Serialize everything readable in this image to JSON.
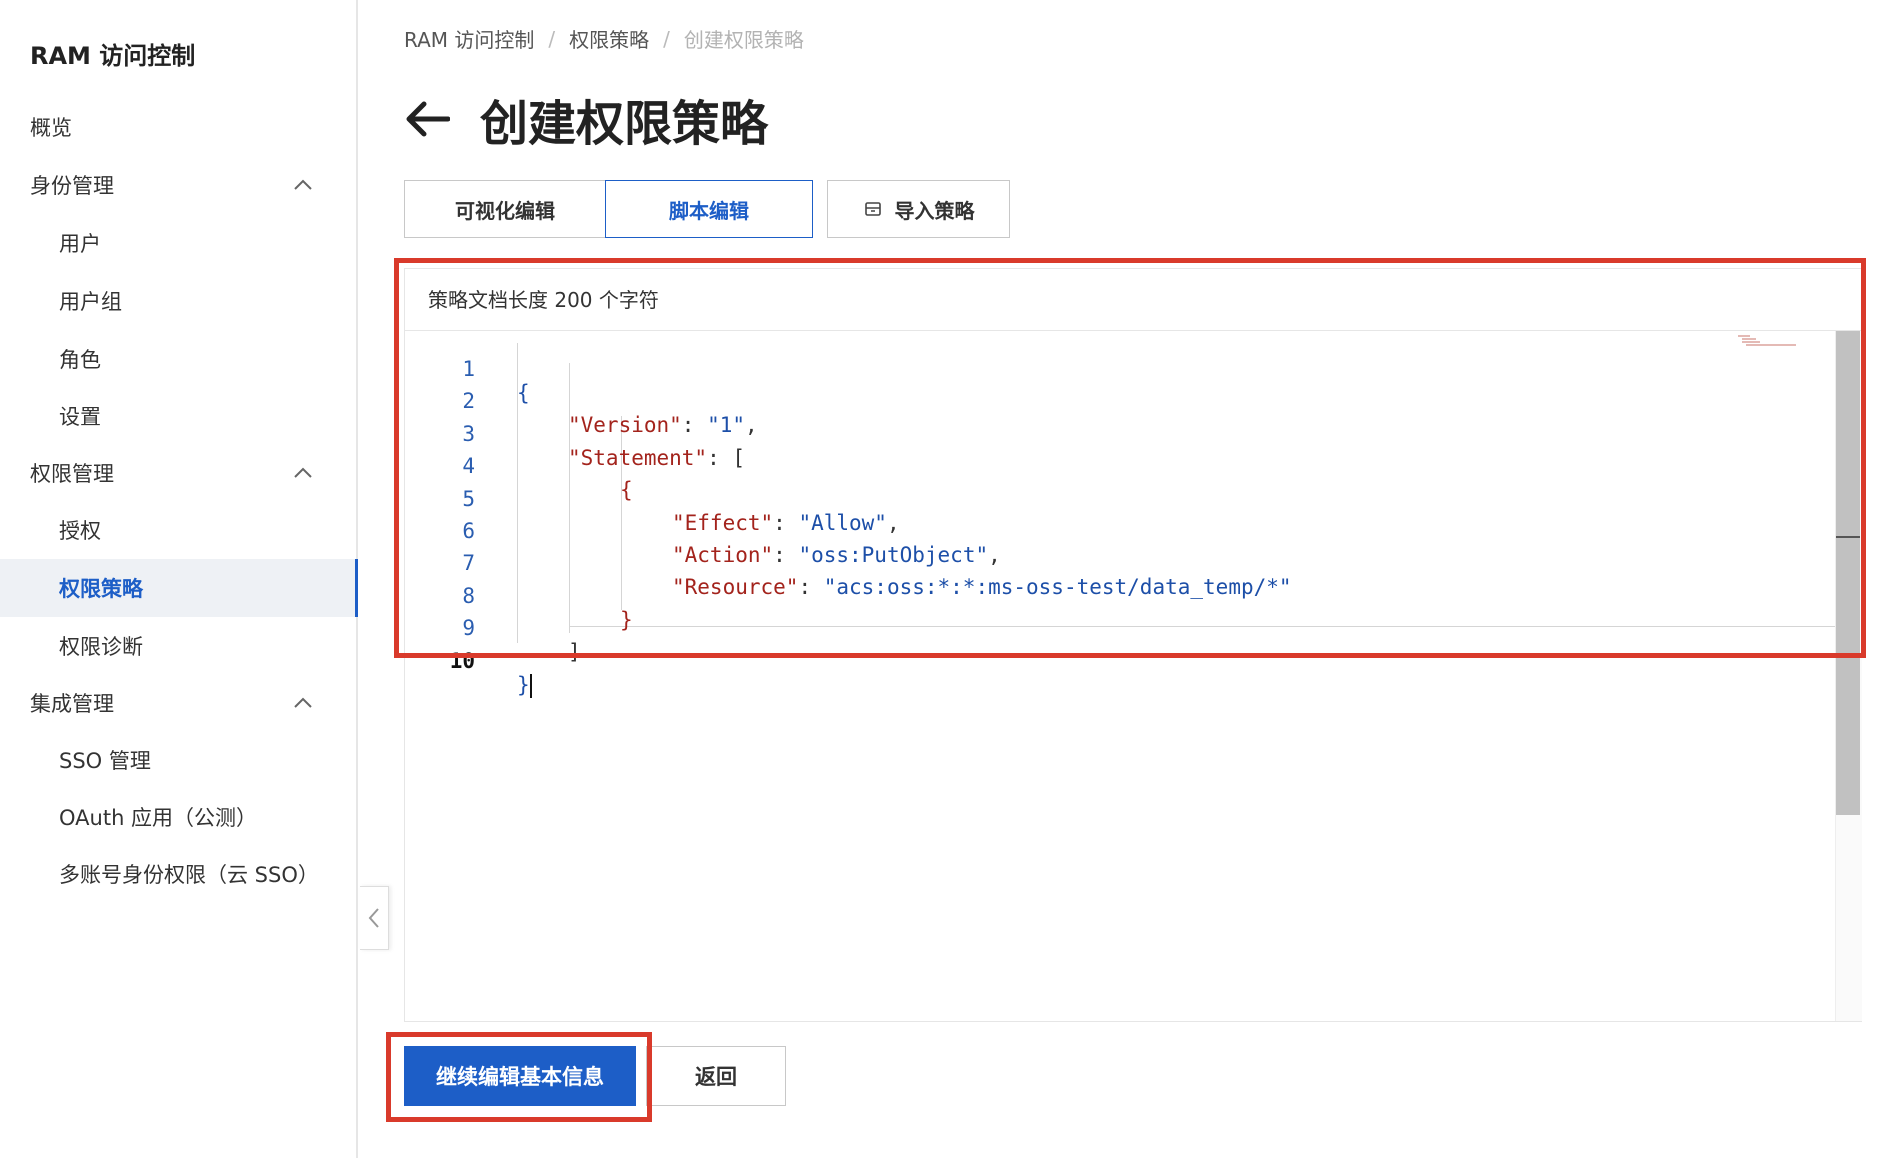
{
  "sidebar": {
    "title": "RAM 访问控制",
    "items": [
      {
        "label": "概览"
      },
      {
        "label": "身份管理"
      },
      {
        "label": "用户"
      },
      {
        "label": "用户组"
      },
      {
        "label": "角色"
      },
      {
        "label": "设置"
      },
      {
        "label": "权限管理"
      },
      {
        "label": "授权"
      },
      {
        "label": "权限策略",
        "active": true
      },
      {
        "label": "权限诊断"
      },
      {
        "label": "集成管理"
      },
      {
        "label": "SSO 管理"
      },
      {
        "label": "OAuth 应用（公测）"
      },
      {
        "label": "多账号身份权限（云 SSO）"
      }
    ]
  },
  "breadcrumb": {
    "items": [
      "RAM 访问控制",
      "权限策略",
      "创建权限策略"
    ],
    "separator": "/"
  },
  "page": {
    "title": "创建权限策略"
  },
  "tabs": {
    "visual": "可视化编辑",
    "script": "脚本编辑",
    "import": "导入策略",
    "active": "脚本编辑"
  },
  "editor": {
    "doc_length_text": "策略文档长度 200 个字符",
    "lines": [
      {
        "num": "1",
        "text": "{"
      },
      {
        "num": "2",
        "text": "\"Version\": \"1\","
      },
      {
        "num": "3",
        "text": "\"Statement\": ["
      },
      {
        "num": "4",
        "text": "{"
      },
      {
        "num": "5",
        "text": "\"Effect\": \"Allow\","
      },
      {
        "num": "6",
        "text": "\"Action\": \"oss:PutObject\","
      },
      {
        "num": "7",
        "text": "\"Resource\": \"acs:oss:*:*:ms-oss-test/data_temp/*\""
      },
      {
        "num": "8",
        "text": "}"
      },
      {
        "num": "9",
        "text": "]"
      },
      {
        "num": "10",
        "text": "}"
      }
    ],
    "tokens": {
      "l1_open": "{",
      "l2_key": "\"Version\"",
      "l2_colon": ": ",
      "l2_val": "\"1\"",
      "l2_comma": ",",
      "l3_key": "\"Statement\"",
      "l3_rest": ": [",
      "l4_open": "{",
      "l5_key": "\"Effect\"",
      "l5_colon": ": ",
      "l5_val": "\"Allow\"",
      "l5_comma": ",",
      "l6_key": "\"Action\"",
      "l6_colon": ": ",
      "l6_val": "\"oss:PutObject\"",
      "l6_comma": ",",
      "l7_key": "\"Resource\"",
      "l7_colon": ": ",
      "l7_val": "\"acs:oss:*:*:ms-oss-test/data_temp/*\"",
      "l8_close": "}",
      "l9_close": "]",
      "l10_close": "}"
    }
  },
  "actions": {
    "continue": "继续编辑基本信息",
    "back": "返回"
  },
  "colors": {
    "primary": "#1d5ec7",
    "highlight": "#d93a2b",
    "json_key": "#a3231c",
    "json_string": "#1d4fa8"
  }
}
